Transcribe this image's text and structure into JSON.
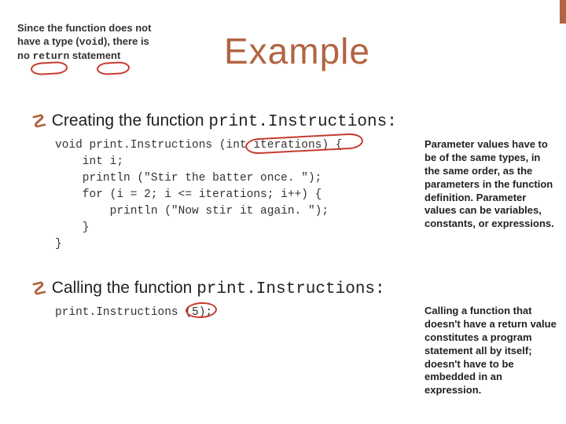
{
  "title": "Example",
  "note_top": {
    "l1": "Since the function does not",
    "l2a": "have a type (",
    "l2b": "void",
    "l2c": "), there is",
    "l3a": "no ",
    "l3b": "return",
    "l3c": " statement"
  },
  "bullets": {
    "b1_pre": "Creating the function ",
    "b1_code": "print.Instructions:",
    "b2_pre": "Calling the function ",
    "b2_code": "print.Instructions:"
  },
  "code1": "void print.Instructions (int iterations) {\n    int i;\n    println (\"Stir the batter once. \");\n    for (i = 2; i <= iterations; i++) {\n        println (\"Now stir it again. \");\n    }\n}",
  "code2": "print.Instructions (5);",
  "anno1": "Parameter values have to be of the same types, in the same order, as the parameters in the function definition. Parameter values can be variables, constants, or expressions.",
  "anno2": "Calling a function that doesn't have a return value constitutes a program statement all by itself; doesn't have to be embedded in an expression."
}
